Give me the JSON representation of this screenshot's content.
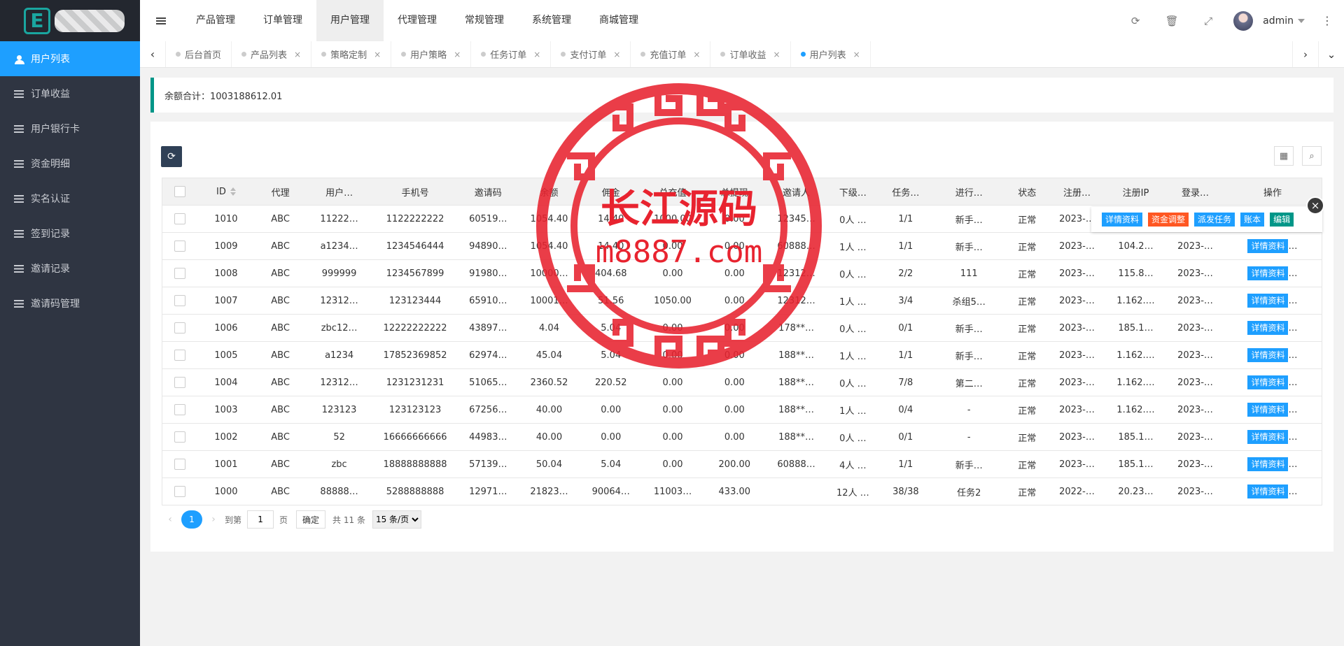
{
  "sidebar": {
    "items": [
      {
        "label": "用户列表",
        "icon": "users-icon",
        "active": true
      },
      {
        "label": "订单收益",
        "icon": "list-icon"
      },
      {
        "label": "用户银行卡",
        "icon": "list-icon"
      },
      {
        "label": "资金明细",
        "icon": "list-icon"
      },
      {
        "label": "实名认证",
        "icon": "list-icon"
      },
      {
        "label": "签到记录",
        "icon": "list-icon"
      },
      {
        "label": "邀请记录",
        "icon": "list-icon"
      },
      {
        "label": "邀请码管理",
        "icon": "list-icon"
      }
    ]
  },
  "header": {
    "nav": [
      "产品管理",
      "订单管理",
      "用户管理",
      "代理管理",
      "常规管理",
      "系统管理",
      "商城管理"
    ],
    "active_nav": "用户管理",
    "user": "admin"
  },
  "tabs": [
    {
      "label": "后台首页",
      "closable": false
    },
    {
      "label": "产品列表",
      "closable": true
    },
    {
      "label": "策略定制",
      "closable": true
    },
    {
      "label": "用户策略",
      "closable": true
    },
    {
      "label": "任务订单",
      "closable": true
    },
    {
      "label": "支付订单",
      "closable": true
    },
    {
      "label": "充值订单",
      "closable": true
    },
    {
      "label": "订单收益",
      "closable": true
    },
    {
      "label": "用户列表",
      "closable": true,
      "active": true
    }
  ],
  "summary": {
    "text": "余额合计：1003188612.01"
  },
  "table": {
    "headers": [
      "ID",
      "代理",
      "用户…",
      "手机号",
      "邀请码",
      "余额",
      "佣金",
      "总充值",
      "总提现",
      "邀请人",
      "下级…",
      "任务…",
      "进行…",
      "状态",
      "注册…",
      "注册IP",
      "登录…",
      "操作"
    ],
    "rows": [
      [
        "1010",
        "ABC",
        "11222…",
        "1122222222",
        "60519…",
        "1054.40",
        "14.40",
        "1000.00",
        "0.00",
        "12345…",
        "0人 …",
        "1/1",
        "新手…",
        "正常",
        "2023-…",
        "",
        "",
        ""
      ],
      [
        "1009",
        "ABC",
        "a1234…",
        "1234546444",
        "94890…",
        "1054.40",
        "14.40",
        "0.00",
        "0.00",
        "60888…",
        "1人 …",
        "1/1",
        "新手…",
        "正常",
        "2023-…",
        "104.2…",
        "2023-…",
        "详情资料"
      ],
      [
        "1008",
        "ABC",
        "999999",
        "1234567899",
        "91980…",
        "10000…",
        "404.68",
        "0.00",
        "0.00",
        "12312…",
        "0人 …",
        "2/2",
        "111",
        "正常",
        "2023-…",
        "115.8…",
        "2023-…",
        "详情资料"
      ],
      [
        "1007",
        "ABC",
        "12312…",
        "123123444",
        "65910…",
        "10001…",
        "51.56",
        "1050.00",
        "0.00",
        "12312…",
        "1人 …",
        "3/4",
        "杀组5…",
        "正常",
        "2023-…",
        "1.162.…",
        "2023-…",
        "详情资料"
      ],
      [
        "1006",
        "ABC",
        "zbc12…",
        "12222222222",
        "43897…",
        "4.04",
        "5.04",
        "0.00",
        "0.00",
        "178**…",
        "0人 …",
        "0/1",
        "新手…",
        "正常",
        "2023-…",
        "185.1…",
        "2023-…",
        "详情资料"
      ],
      [
        "1005",
        "ABC",
        "a1234",
        "17852369852",
        "62974…",
        "45.04",
        "5.04",
        "0.00",
        "0.00",
        "188**…",
        "1人 …",
        "1/1",
        "新手…",
        "正常",
        "2023-…",
        "1.162.…",
        "2023-…",
        "详情资料"
      ],
      [
        "1004",
        "ABC",
        "12312…",
        "1231231231",
        "51065…",
        "2360.52",
        "220.52",
        "0.00",
        "0.00",
        "188**…",
        "0人 …",
        "7/8",
        "第二…",
        "正常",
        "2023-…",
        "1.162.…",
        "2023-…",
        "详情资料"
      ],
      [
        "1003",
        "ABC",
        "123123",
        "123123123",
        "67256…",
        "40.00",
        "0.00",
        "0.00",
        "0.00",
        "188**…",
        "1人 …",
        "0/4",
        "-",
        "正常",
        "2023-…",
        "1.162.…",
        "2023-…",
        "详情资料"
      ],
      [
        "1002",
        "ABC",
        "52",
        "16666666666",
        "44983…",
        "40.00",
        "0.00",
        "0.00",
        "0.00",
        "188**…",
        "0人 …",
        "0/1",
        "-",
        "正常",
        "2023-…",
        "185.1…",
        "2023-…",
        "详情资料"
      ],
      [
        "1001",
        "ABC",
        "zbc",
        "18888888888",
        "57139…",
        "50.04",
        "5.04",
        "0.00",
        "200.00",
        "60888…",
        "4人 …",
        "1/1",
        "新手…",
        "正常",
        "2023-…",
        "185.1…",
        "2023-…",
        "详情资料"
      ],
      [
        "1000",
        "ABC",
        "88888…",
        "5288888888",
        "12971…",
        "21823…",
        "90064…",
        "11003…",
        "433.00",
        "",
        "12人 …",
        "38/38",
        "任务2",
        "正常",
        "2022-…",
        "20.23…",
        "2023-…",
        "详情资料"
      ]
    ]
  },
  "row_actions": [
    {
      "label": "详情资料",
      "color": "#1e9fff"
    },
    {
      "label": "资金调整",
      "color": "#ff5722"
    },
    {
      "label": "派发任务",
      "color": "#1e9fff"
    },
    {
      "label": "账本",
      "color": "#1e9fff"
    },
    {
      "label": "编辑",
      "color": "#009688"
    }
  ],
  "pager": {
    "current": "1",
    "goto_prefix": "到第",
    "goto_value": "1",
    "goto_suffix": "页",
    "confirm": "确定",
    "total": "共 11 条",
    "page_size": "15 条/页"
  },
  "watermark": {
    "line1": "长江源码",
    "line2": "m8887.com",
    "color": "#e8232f"
  }
}
